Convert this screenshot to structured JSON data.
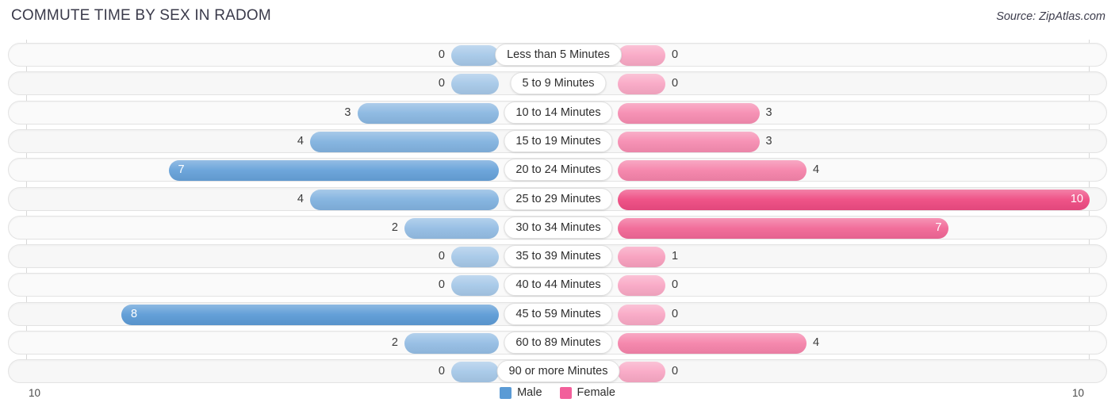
{
  "header": {
    "title": "COMMUTE TIME BY SEX IN RADOM",
    "source": "Source: ZipAtlas.com"
  },
  "legend": {
    "male_label": "Male",
    "female_label": "Female",
    "male_color": "#5B9BD5",
    "female_color": "#F2609B"
  },
  "axis": {
    "left_label": "10",
    "right_label": "10"
  },
  "chart_data": {
    "type": "bar",
    "orientation": "horizontal-diverging",
    "title": "COMMUTE TIME BY SEX IN RADOM",
    "xlabel": "",
    "ylabel": "",
    "axis_max": 10,
    "grid": true,
    "legend_position": "bottom-center",
    "categories": [
      "Less than 5 Minutes",
      "5 to 9 Minutes",
      "10 to 14 Minutes",
      "15 to 19 Minutes",
      "20 to 24 Minutes",
      "25 to 29 Minutes",
      "30 to 34 Minutes",
      "35 to 39 Minutes",
      "40 to 44 Minutes",
      "45 to 59 Minutes",
      "60 to 89 Minutes",
      "90 or more Minutes"
    ],
    "series": [
      {
        "name": "Male",
        "values": [
          0,
          0,
          3,
          4,
          7,
          4,
          2,
          0,
          0,
          8,
          2,
          0
        ]
      },
      {
        "name": "Female",
        "values": [
          0,
          0,
          3,
          3,
          4,
          10,
          7,
          1,
          0,
          0,
          4,
          0
        ]
      }
    ]
  },
  "rows": [
    {
      "label": "Less than 5 Minutes",
      "male": 0,
      "male_text": "0",
      "female": 0,
      "female_text": "0"
    },
    {
      "label": "5 to 9 Minutes",
      "male": 0,
      "male_text": "0",
      "female": 0,
      "female_text": "0"
    },
    {
      "label": "10 to 14 Minutes",
      "male": 3,
      "male_text": "3",
      "female": 3,
      "female_text": "3"
    },
    {
      "label": "15 to 19 Minutes",
      "male": 4,
      "male_text": "4",
      "female": 3,
      "female_text": "3"
    },
    {
      "label": "20 to 24 Minutes",
      "male": 7,
      "male_text": "7",
      "female": 4,
      "female_text": "4"
    },
    {
      "label": "25 to 29 Minutes",
      "male": 4,
      "male_text": "4",
      "female": 10,
      "female_text": "10"
    },
    {
      "label": "30 to 34 Minutes",
      "male": 2,
      "male_text": "2",
      "female": 7,
      "female_text": "7"
    },
    {
      "label": "35 to 39 Minutes",
      "male": 0,
      "male_text": "0",
      "female": 1,
      "female_text": "1"
    },
    {
      "label": "40 to 44 Minutes",
      "male": 0,
      "male_text": "0",
      "female": 0,
      "female_text": "0"
    },
    {
      "label": "45 to 59 Minutes",
      "male": 8,
      "male_text": "8",
      "female": 0,
      "female_text": "0"
    },
    {
      "label": "60 to 89 Minutes",
      "male": 2,
      "male_text": "2",
      "female": 4,
      "female_text": "4"
    },
    {
      "label": "90 or more Minutes",
      "male": 0,
      "male_text": "0",
      "female": 0,
      "female_text": "0"
    }
  ]
}
